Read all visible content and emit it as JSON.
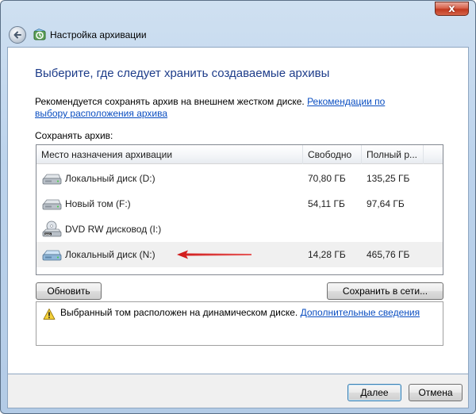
{
  "window": {
    "title": "Настройка архивации",
    "close_label": "x"
  },
  "page": {
    "heading": "Выберите, где следует хранить создаваемые архивы",
    "recommend_text": "Рекомендуется сохранять архив на внешнем жестком диске.",
    "recommend_link": "Рекомендации по выбору расположения архива",
    "save_label": "Сохранять архив:"
  },
  "table": {
    "columns": [
      "Место назначения архивации",
      "Свободно",
      "Полный р..."
    ],
    "rows": [
      {
        "name": "Локальный диск (D:)",
        "free": "70,80 ГБ",
        "total": "135,25 ГБ",
        "icon": "hard-drive-icon"
      },
      {
        "name": "Новый том (F:)",
        "free": "54,11 ГБ",
        "total": "97,64 ГБ",
        "icon": "hard-drive-icon"
      },
      {
        "name": "DVD RW дисковод (I:)",
        "free": "",
        "total": "",
        "icon": "dvd-drive-icon"
      },
      {
        "name": "Локальный диск (N:)",
        "free": "14,28 ГБ",
        "total": "465,76 ГБ",
        "icon": "hard-drive-icon",
        "selected": true
      }
    ]
  },
  "buttons": {
    "refresh": "Обновить",
    "save_network": "Сохранить в сети...",
    "next": "Далее",
    "cancel": "Отмена"
  },
  "info": {
    "text": "Выбранный том расположен на динамическом диске.",
    "link": "Дополнительные сведения"
  },
  "colors": {
    "heading": "#1e3d8a",
    "link": "#0a4ec1",
    "arrow": "#d01818"
  }
}
